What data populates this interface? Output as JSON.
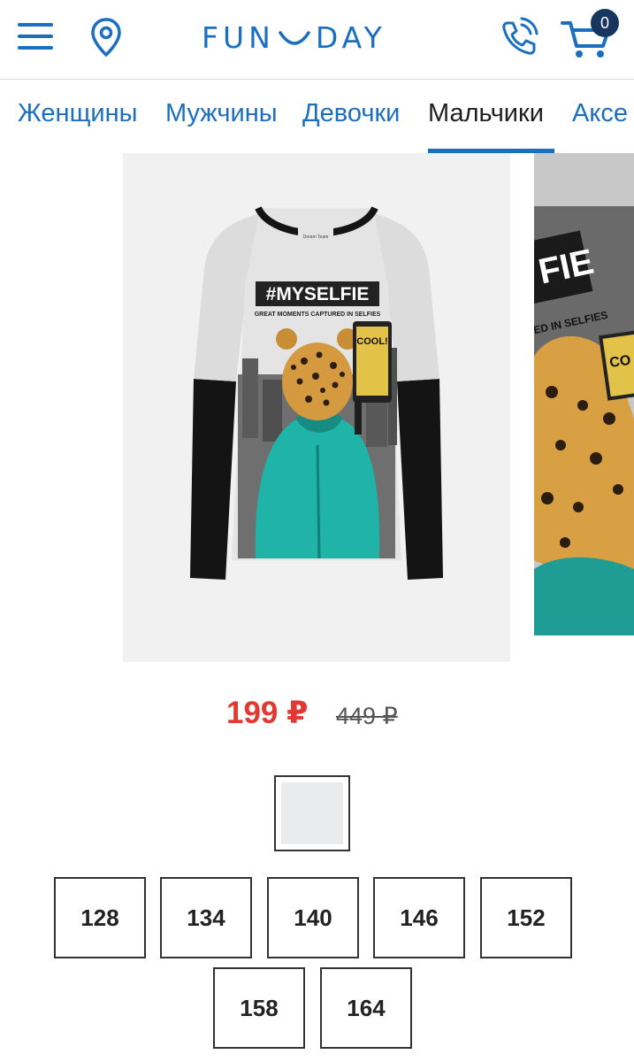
{
  "header": {
    "logo_left": "FUN",
    "logo_right": "DAY",
    "cart_count": "0"
  },
  "categories": [
    {
      "label": "Женщины"
    },
    {
      "label": "Мужчины"
    },
    {
      "label": "Девочки"
    },
    {
      "label": "Мальчики",
      "active": true
    },
    {
      "label": "Аксе"
    }
  ],
  "product": {
    "print_title": "#MYSELFIE",
    "print_subtitle": "GREAT MOMENTS CAPTURED IN SELFIES",
    "phone_screen_text": "COOL!",
    "tag_text": "Dream Team",
    "next_photo_text": "FIE",
    "next_photo_subtext": "ED IN SELFIES",
    "next_phone_text": "CO",
    "price_current": "199 ₽",
    "price_old": "449 ₽",
    "color_swatch": "#e9ebec",
    "sizes": [
      "128",
      "134",
      "140",
      "146",
      "152",
      "158",
      "164"
    ]
  },
  "colors": {
    "brand_blue": "#1b6fc0",
    "badge_navy": "#17365e",
    "price_red": "#e23a33",
    "shirt_teal": "#20b3a7"
  }
}
